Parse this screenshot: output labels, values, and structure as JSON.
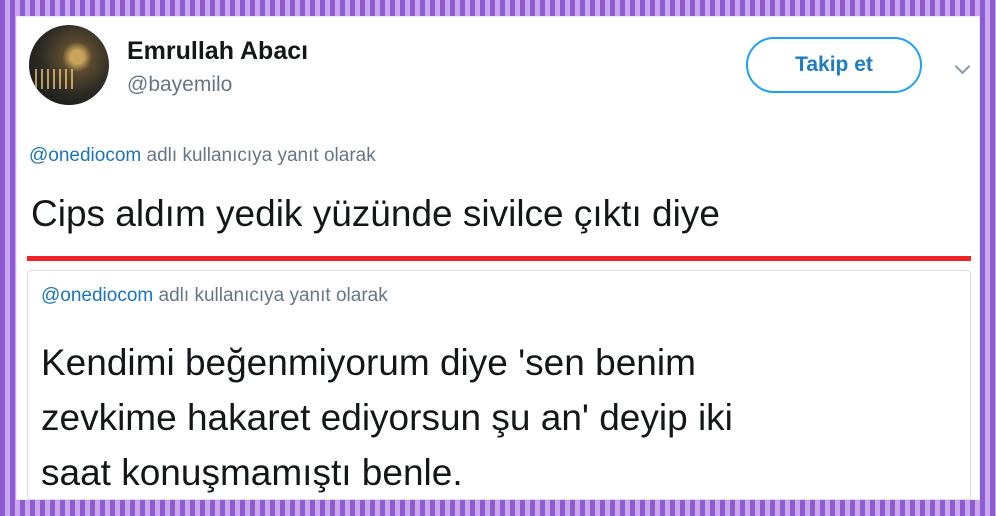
{
  "user": {
    "name": "Emrullah Abacı",
    "handle": "@bayemilo"
  },
  "follow_button_label": "Takip et",
  "reply1": {
    "mention": "@onediocom",
    "text": " adlı kullanıcıya yanıt olarak"
  },
  "tweet1": "Cips aldım yedik yüzünde sivilce çıktı diye",
  "reply2": {
    "mention": "@onediocom",
    "text": " adlı kullanıcıya yanıt olarak"
  },
  "tweet2_lines": [
    "Kendimi beğenmiyorum diye 'sen benim",
    "zevkime hakaret ediyorsun şu an' deyip iki",
    "saat konuşmamıştı benle."
  ],
  "colors": {
    "accent": "#1da1f2",
    "mention": "#1b75bb",
    "divider": "#ee2222",
    "border_purple": "#8e5bd1"
  }
}
